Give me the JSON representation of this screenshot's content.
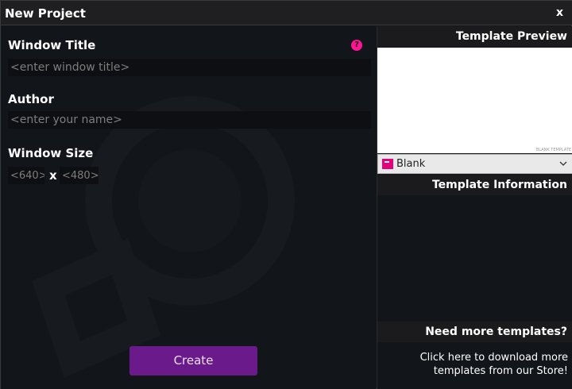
{
  "window": {
    "title": "New Project",
    "close_label": "x"
  },
  "form": {
    "window_title_label": "Window Title",
    "window_title_placeholder": "<enter window title>",
    "help_icon": "question-circle-icon",
    "author_label": "Author",
    "author_placeholder": "<enter your name>",
    "window_size_label": "Window Size",
    "width_placeholder": "<640>",
    "size_separator": "x",
    "height_placeholder": "<480>",
    "create_label": "Create"
  },
  "sidebar": {
    "preview_header": "Template Preview",
    "preview_caption": "BLANK TEMPLATE",
    "selected_template": "Blank",
    "info_header": "Template Information",
    "more_header": "Need more templates?",
    "store_link_text": "Click here to download more templates from our Store!"
  },
  "colors": {
    "accent_pink": "#ff1493",
    "create_button": "#6b1a8c",
    "background": "#121519",
    "header_bg": "#1b1b1d"
  }
}
